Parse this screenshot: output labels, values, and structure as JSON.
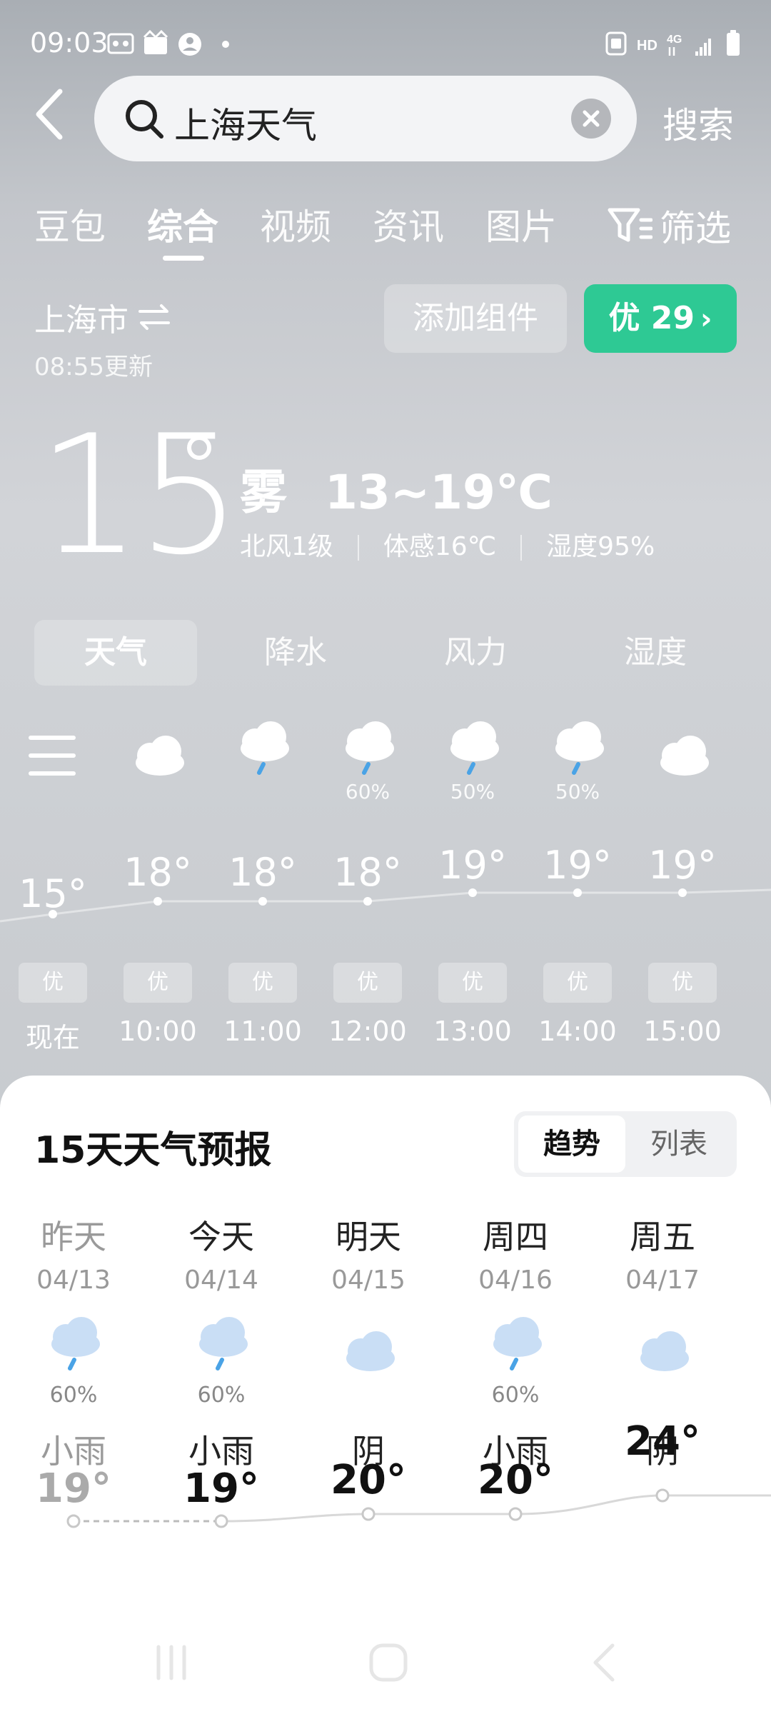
{
  "status_bar": {
    "time": "09:03",
    "network": "4G",
    "hd": "HD"
  },
  "search": {
    "query": "上海天气",
    "button": "搜索"
  },
  "tabs": [
    {
      "label": "豆包"
    },
    {
      "label": "综合"
    },
    {
      "label": "视频"
    },
    {
      "label": "资讯"
    },
    {
      "label": "图片"
    },
    {
      "label": "筛选"
    }
  ],
  "active_tab": "综合",
  "location": {
    "city": "上海市",
    "updated": "08:55更新"
  },
  "add_widget": "添加组件",
  "aqi": {
    "label": "优 29"
  },
  "current": {
    "temp": "15",
    "condition": "雾",
    "range": "13~19℃",
    "wind": "北风1级",
    "feels_like": "体感16℃",
    "humidity": "湿度95%"
  },
  "segments": [
    {
      "label": "天气"
    },
    {
      "label": "降水"
    },
    {
      "label": "风力"
    },
    {
      "label": "湿度"
    }
  ],
  "hourly": [
    {
      "time": "现在",
      "temp": "15°",
      "aqi": "优",
      "prob": "",
      "icon": "cloudy-icon",
      "t": 15
    },
    {
      "time": "10:00",
      "temp": "18°",
      "aqi": "优",
      "prob": "",
      "icon": "cloudy-icon",
      "t": 18
    },
    {
      "time": "11:00",
      "temp": "18°",
      "aqi": "优",
      "prob": "",
      "icon": "rain-cloud-icon",
      "t": 18
    },
    {
      "time": "12:00",
      "temp": "18°",
      "aqi": "优",
      "prob": "60%",
      "icon": "rain-cloud-icon",
      "t": 18
    },
    {
      "time": "13:00",
      "temp": "19°",
      "aqi": "优",
      "prob": "50%",
      "icon": "rain-cloud-icon",
      "t": 19
    },
    {
      "time": "14:00",
      "temp": "19°",
      "aqi": "优",
      "prob": "50%",
      "icon": "rain-cloud-icon",
      "t": 19
    },
    {
      "time": "15:00",
      "temp": "19°",
      "aqi": "优",
      "prob": "",
      "icon": "cloudy-icon",
      "t": 19
    }
  ],
  "forecast": {
    "title": "15天天气预报",
    "toggle": [
      "趋势",
      "列表"
    ],
    "days": [
      {
        "name": "昨天",
        "date": "04/13",
        "prob": "60%",
        "cond": "小雨",
        "temp": "19°",
        "t": 19,
        "icon": "rain-cloud-icon",
        "past": true
      },
      {
        "name": "今天",
        "date": "04/14",
        "prob": "60%",
        "cond": "小雨",
        "temp": "19°",
        "t": 19,
        "icon": "rain-cloud-icon",
        "past": false
      },
      {
        "name": "明天",
        "date": "04/15",
        "prob": "",
        "cond": "阴",
        "temp": "20°",
        "t": 20,
        "icon": "overcast-icon",
        "past": false
      },
      {
        "name": "周四",
        "date": "04/16",
        "prob": "60%",
        "cond": "小雨",
        "temp": "20°",
        "t": 20,
        "icon": "rain-cloud-icon",
        "past": false
      },
      {
        "name": "周五",
        "date": "04/17",
        "prob": "",
        "cond": "阴",
        "temp": "24°",
        "t": 24,
        "icon": "overcast-icon",
        "past": false
      }
    ]
  }
}
